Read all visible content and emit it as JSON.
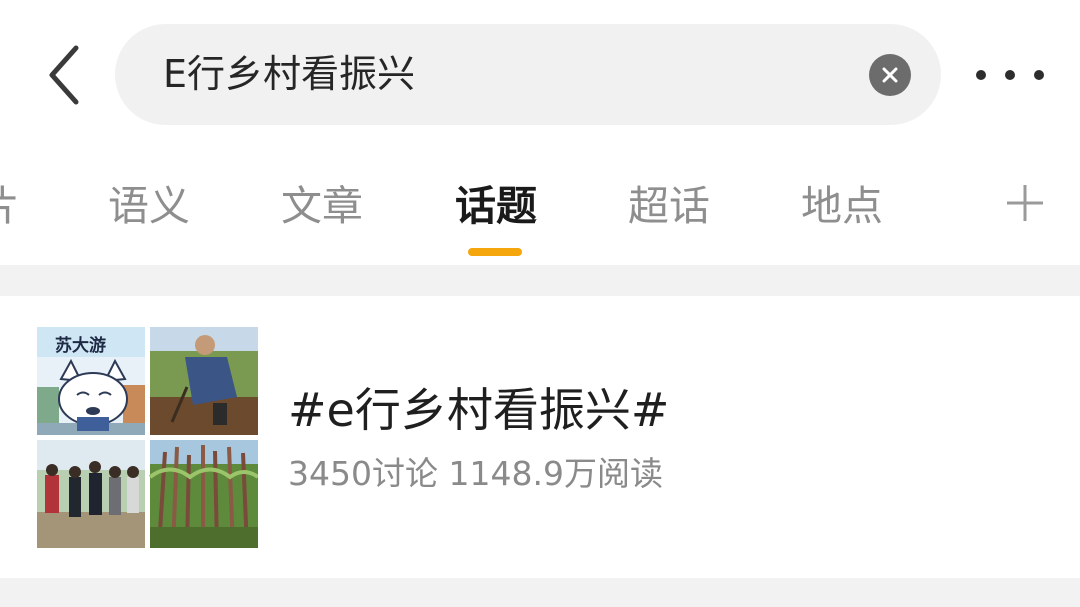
{
  "header": {
    "search_query": "E行乡村看振兴",
    "back_icon": "chevron-left-icon",
    "clear_icon": "clear-circle-icon",
    "more_icon": "more-dots-icon"
  },
  "tabs": {
    "partial_label": "片",
    "items": [
      {
        "label": "语义",
        "active": false
      },
      {
        "label": "文章",
        "active": false
      },
      {
        "label": "话题",
        "active": true
      },
      {
        "label": "超话",
        "active": false
      },
      {
        "label": "地点",
        "active": false
      }
    ],
    "add_icon": "plus-icon",
    "accent_color": "#f4a60c"
  },
  "topic": {
    "title": "#e行乡村看振兴#",
    "stats": "3450讨论 1148.9万阅读",
    "thumbnail": {
      "logo_text": "苏大游"
    }
  }
}
